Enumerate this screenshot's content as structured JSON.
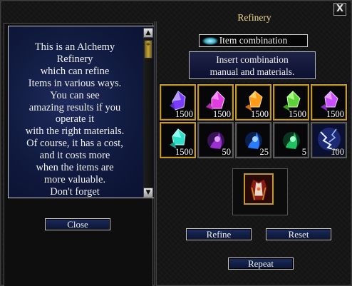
{
  "window": {
    "title": "Refinery",
    "close_glyph": "X"
  },
  "info": {
    "text": "This is an Alchemy\nRefinery\nwhich can refine\nItems in various ways.\nYou can see\namazing results if you\noperate it\nwith the right materials.\nOf course, it has a cost,\nand it costs more\nwhen the items are\nmore valuable.\nDon't forget",
    "scroll_up_glyph": "▲",
    "scroll_down_glyph": "▼",
    "scroll_thumb_glyph": "≑"
  },
  "left_buttons": {
    "close_label": "Close"
  },
  "combination": {
    "label": "Item combination",
    "instruction": "Insert combination\nmanual and materials."
  },
  "materials": [
    {
      "name": "purple-gem",
      "color": "#7a3cff",
      "qty": "1500"
    },
    {
      "name": "magenta-gem",
      "color": "#e03ce0",
      "qty": "1500"
    },
    {
      "name": "orange-gem",
      "color": "#ff9a1a",
      "qty": "1500"
    },
    {
      "name": "green-gem",
      "color": "#5fd23a",
      "qty": "1500"
    },
    {
      "name": "violet-gem",
      "color": "#c850ff",
      "qty": "1500"
    },
    {
      "name": "teal-gem",
      "color": "#2ee0c8",
      "qty": "1500"
    },
    {
      "name": "purple-essence",
      "color": "#9a30d0",
      "qty": "50"
    },
    {
      "name": "blue-essence",
      "color": "#2a7aff",
      "qty": "25"
    },
    {
      "name": "green-essence",
      "color": "#1fc060",
      "qty": "5"
    },
    {
      "name": "lightning-scroll",
      "color": "#6a8aff",
      "qty": "100"
    }
  ],
  "result": {
    "item": "refined-armor-icon"
  },
  "actions": {
    "refine_label": "Refine",
    "reset_label": "Reset",
    "repeat_label": "Repeat"
  },
  "colors": {
    "title": "#ecd58a",
    "slot_border": "#c29a2a",
    "button_fill": "#13204a"
  }
}
